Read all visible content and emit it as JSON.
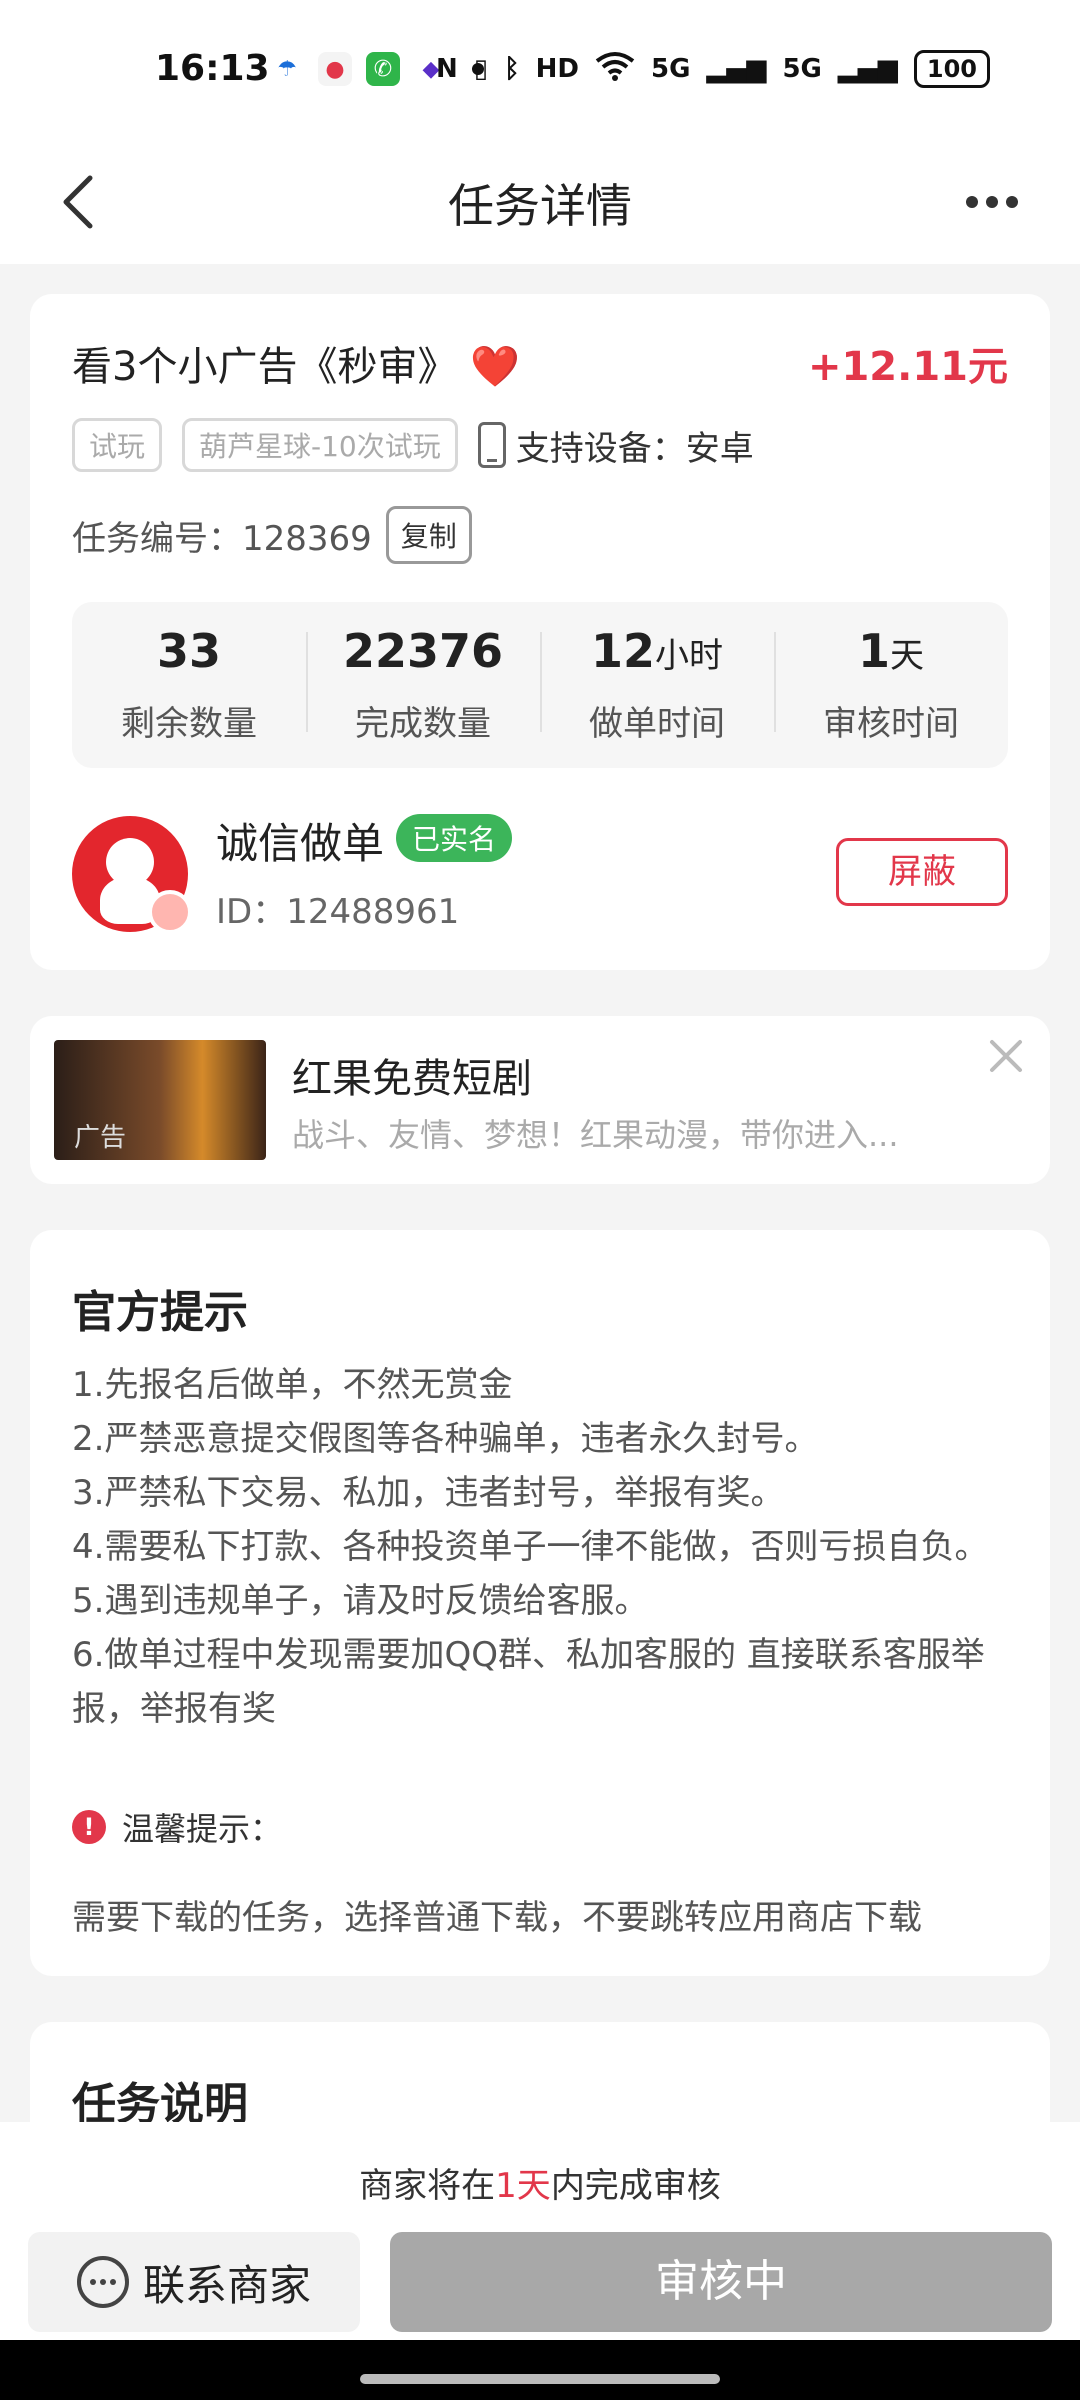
{
  "statusbar": {
    "time": "16:13",
    "right_labels": [
      "N",
      "HD",
      "5G",
      "5G"
    ],
    "battery": "100"
  },
  "nav": {
    "title": "任务详情"
  },
  "task": {
    "title": "看3个小广告《秒审》",
    "heart": "❤️",
    "price": "+12.11元",
    "tags": [
      "试玩",
      "葫芦星球-10次试玩"
    ],
    "device": "支持设备：安卓",
    "task_no": "任务编号：128369",
    "copy_label": "复制"
  },
  "stats": [
    {
      "value": "33",
      "unit": "",
      "label": "剩余数量"
    },
    {
      "value": "22376",
      "unit": "",
      "label": "完成数量"
    },
    {
      "value": "12",
      "unit": "小时",
      "label": "做单时间"
    },
    {
      "value": "1",
      "unit": "天",
      "label": "审核时间"
    }
  ],
  "seller": {
    "name": "诚信做单",
    "verified": "已实名",
    "id": "ID：12488961",
    "block_label": "屏蔽"
  },
  "ad": {
    "label": "广告",
    "title": "红果免费短剧",
    "desc": "战斗、友情、梦想！红果动漫，带你进入..."
  },
  "notice": {
    "title": "官方提示",
    "tips": [
      "1.先报名后做单，不然无赏金",
      "2.严禁恶意提交假图等各种骗单，违者永久封号。",
      "3.严禁私下交易、私加，违者封号，举报有奖。",
      "4.需要私下打款、各种投资单子一律不能做，否则亏损自负。",
      "5.遇到违规单子，请及时反馈给客服。",
      "6.做单过程中发现需要加QQ群、私加客服的 直接联系客服举报，举报有奖"
    ],
    "warm_label": "温馨提示：",
    "warm_text": "需要下载的任务，选择普通下载，不要跳转应用商店下载"
  },
  "description": {
    "title": "任务说明"
  },
  "bottom": {
    "review_prefix": "商家将在",
    "review_highlight": "1天",
    "review_suffix": "内完成审核",
    "contact_label": "联系商家",
    "status_label": "审核中"
  },
  "colors": {
    "accent_red": "#e2374a",
    "verified_green": "#3cb55a",
    "disabled_gray": "#a8a8a8"
  }
}
